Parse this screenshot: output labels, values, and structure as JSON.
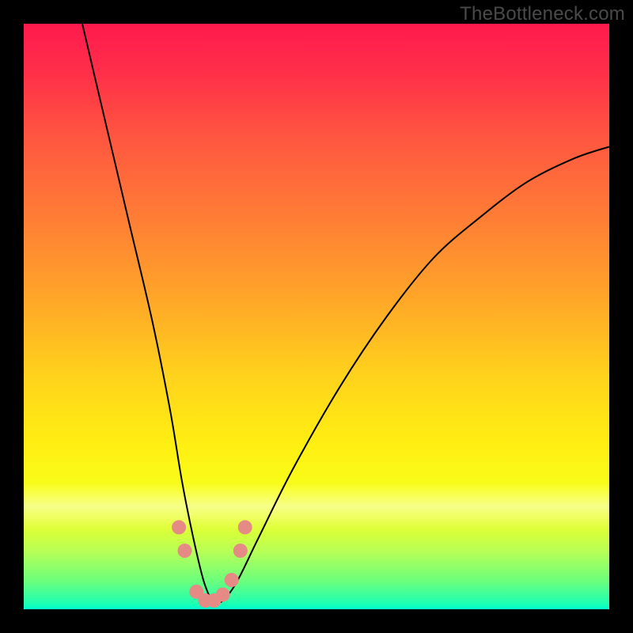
{
  "watermark": "TheBottleneck.com",
  "chart_data": {
    "type": "line",
    "title": "",
    "xlabel": "",
    "ylabel": "",
    "xlim": [
      0,
      100
    ],
    "ylim": [
      0,
      100
    ],
    "grid": false,
    "legend": false,
    "series": [
      {
        "name": "bottleneck-curve",
        "x": [
          10,
          14,
          18,
          22,
          25,
          27,
          29,
          31,
          33,
          36,
          40,
          46,
          54,
          62,
          70,
          78,
          86,
          94,
          100
        ],
        "values": [
          100,
          83,
          66,
          49,
          34,
          22,
          12,
          4,
          1,
          4,
          12,
          24,
          38,
          50,
          60,
          67,
          73,
          77,
          79
        ]
      }
    ],
    "markers": {
      "name": "highlight-dots",
      "color": "#e68a86",
      "points": [
        {
          "x": 26.5,
          "y": 14
        },
        {
          "x": 27.5,
          "y": 10
        },
        {
          "x": 29.5,
          "y": 3
        },
        {
          "x": 31.0,
          "y": 1.5
        },
        {
          "x": 32.5,
          "y": 1.5
        },
        {
          "x": 34.0,
          "y": 2.5
        },
        {
          "x": 35.5,
          "y": 5
        },
        {
          "x": 37.0,
          "y": 10
        },
        {
          "x": 37.8,
          "y": 14
        }
      ]
    },
    "background_gradient": {
      "top": "#ff1a4d",
      "upper_mid": "#ffa02a",
      "mid": "#ffef12",
      "lower": "#6eff7a",
      "bottom": "#00ffd0"
    }
  }
}
